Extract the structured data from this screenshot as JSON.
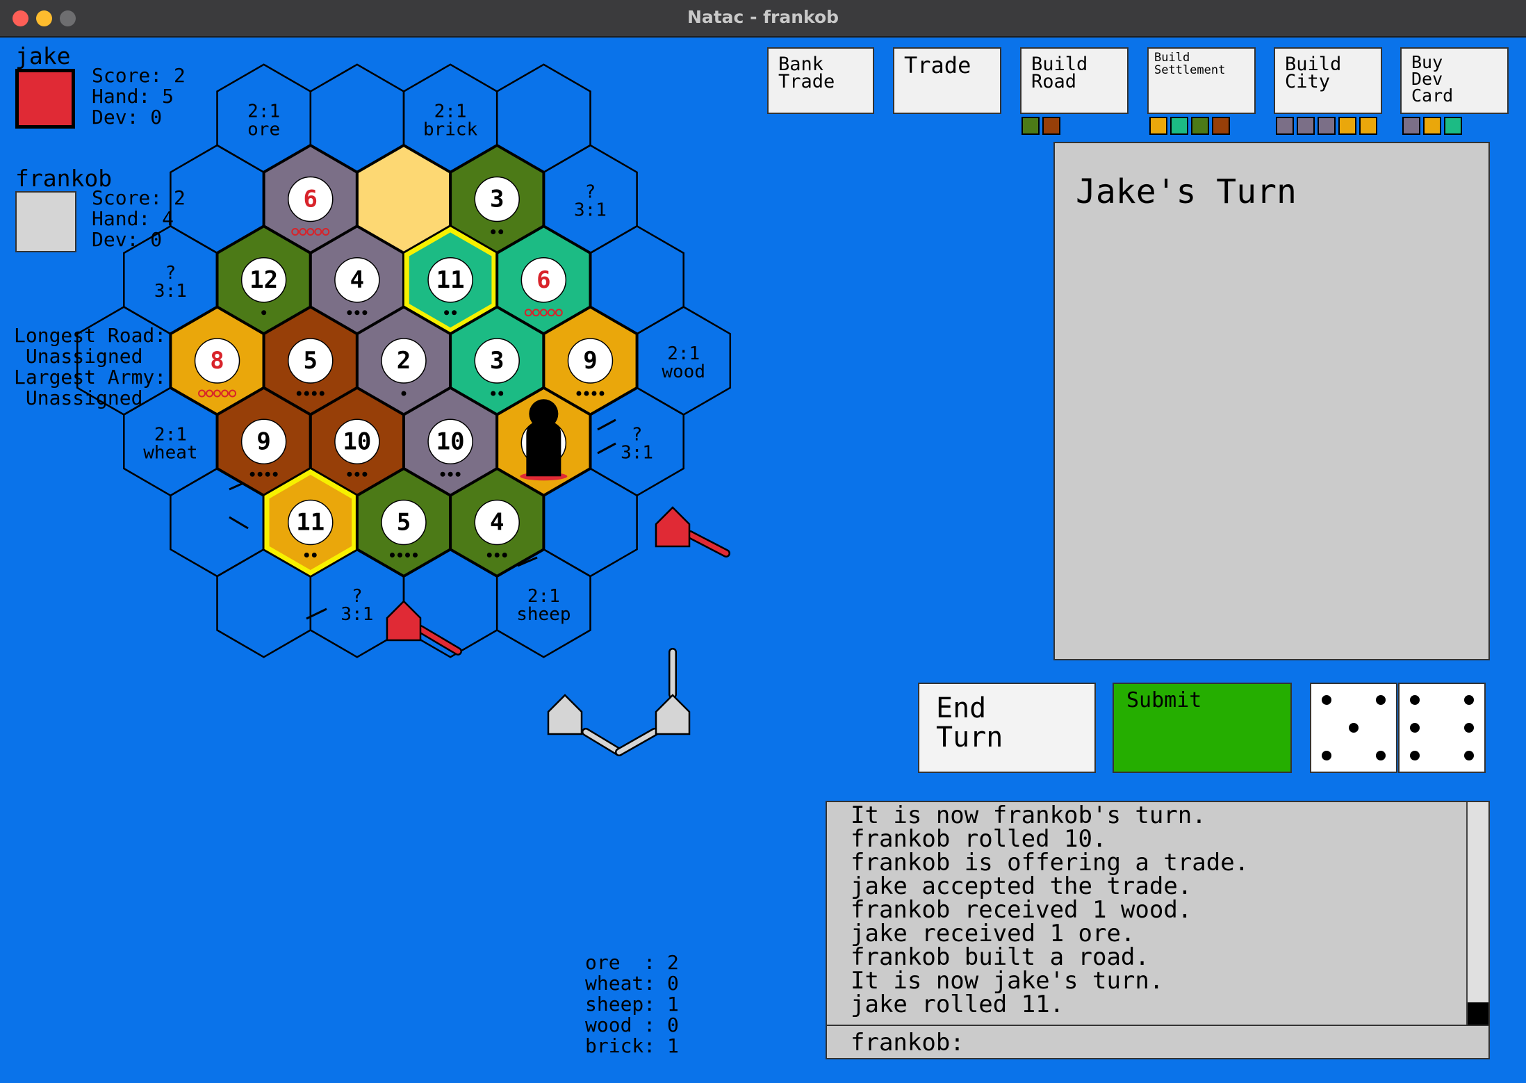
{
  "window": {
    "title": "Natac - frankob"
  },
  "colors": {
    "background": "#0a73ea",
    "ore": "#7b6f87",
    "wheat": "#eaa70b",
    "sheep": "#1cbb84",
    "wood": "#4c7a17",
    "brick": "#973f08",
    "desert": "#fdd873",
    "player_jake": "#e02a35",
    "player_frankob": "#d5d5d5",
    "highlight": "#f7f100",
    "submit": "#25ae00"
  },
  "players": [
    {
      "name": "jake",
      "score_label": "Score: 2",
      "hand_label": "Hand: 5",
      "dev_label": "Dev: 0",
      "color": "#e02a35"
    },
    {
      "name": "frankob",
      "score_label": "Score: 2",
      "hand_label": "Hand: 4",
      "dev_label": "Dev: 0",
      "color": "#d5d5d5"
    }
  ],
  "awards": {
    "longest_road": "Longest Road:",
    "longest_road_value": " Unassigned",
    "largest_army": "Largest Army:",
    "largest_army_value": " Unassigned"
  },
  "buttons": {
    "bank_trade": "Bank\nTrade",
    "trade": "Trade",
    "build_road": "Build\nRoad",
    "build_settlement": "Build\nSettlement",
    "build_city": "Build\nCity",
    "buy_dev_card": "Buy\nDev\nCard",
    "end_turn": "End\nTurn",
    "submit": "Submit"
  },
  "costs": {
    "build_road": [
      "wood",
      "brick"
    ],
    "build_settlement": [
      "wheat",
      "sheep",
      "wood",
      "brick"
    ],
    "build_city": [
      "ore",
      "ore",
      "ore",
      "wheat",
      "wheat"
    ],
    "buy_dev_card": [
      "ore",
      "wheat",
      "sheep"
    ]
  },
  "turn_panel": {
    "title": "Jake's Turn"
  },
  "dice": [
    5,
    6
  ],
  "board": {
    "tiles": [
      {
        "q": 0,
        "r": -2,
        "resource": "ore",
        "number": "6",
        "dots": 5,
        "hot": true
      },
      {
        "q": 1,
        "r": -2,
        "resource": "desert",
        "number": "",
        "dots": 0
      },
      {
        "q": 2,
        "r": -2,
        "resource": "wood",
        "number": "3",
        "dots": 2
      },
      {
        "q": -1,
        "r": -1,
        "resource": "wood",
        "number": "12",
        "dots": 1
      },
      {
        "q": 0,
        "r": -1,
        "resource": "ore",
        "number": "4",
        "dots": 3
      },
      {
        "q": 1,
        "r": -1,
        "resource": "sheep",
        "number": "11",
        "dots": 2,
        "highlight": true
      },
      {
        "q": 2,
        "r": -1,
        "resource": "sheep",
        "number": "6",
        "dots": 5,
        "hot": true
      },
      {
        "q": -2,
        "r": 0,
        "resource": "wheat",
        "number": "8",
        "dots": 5,
        "hot": true
      },
      {
        "q": -1,
        "r": 0,
        "resource": "brick",
        "number": "5",
        "dots": 4
      },
      {
        "q": 0,
        "r": 0,
        "resource": "ore",
        "number": "2",
        "dots": 1
      },
      {
        "q": 1,
        "r": 0,
        "resource": "sheep",
        "number": "3",
        "dots": 2
      },
      {
        "q": 2,
        "r": 0,
        "resource": "wheat",
        "number": "9",
        "dots": 4
      },
      {
        "q": -2,
        "r": 1,
        "resource": "brick",
        "number": "9",
        "dots": 4
      },
      {
        "q": -1,
        "r": 1,
        "resource": "brick",
        "number": "10",
        "dots": 3
      },
      {
        "q": 0,
        "r": 1,
        "resource": "ore",
        "number": "10",
        "dots": 3
      },
      {
        "q": 1,
        "r": 1,
        "resource": "wheat",
        "number": "",
        "dots": 0,
        "robber": true
      },
      {
        "q": -2,
        "r": 2,
        "resource": "wheat",
        "number": "11",
        "dots": 2,
        "highlight": true
      },
      {
        "q": -1,
        "r": 2,
        "resource": "wood",
        "number": "5",
        "dots": 4
      },
      {
        "q": 0,
        "r": 2,
        "resource": "wood",
        "number": "4",
        "dots": 3
      }
    ],
    "ports": [
      {
        "q": 0,
        "r": -3,
        "line1": "2:1",
        "line2": "ore"
      },
      {
        "q": 2,
        "r": -3,
        "line1": "2:1",
        "line2": "brick"
      },
      {
        "q": 3,
        "r": -2,
        "line1": "?",
        "line2": "3:1"
      },
      {
        "q": -2,
        "r": -1,
        "line1": "?",
        "line2": "3:1"
      },
      {
        "q": 3,
        "r": 0,
        "line1": "2:1",
        "line2": "wood"
      },
      {
        "q": -3,
        "r": 1,
        "line1": "2:1",
        "line2": "wheat"
      },
      {
        "q": 2,
        "r": 1,
        "line1": "?",
        "line2": "3:1"
      },
      {
        "q": -2,
        "r": 3,
        "line1": "?",
        "line2": "3:1"
      },
      {
        "q": 0,
        "r": 3,
        "line1": "2:1",
        "line2": "sheep"
      }
    ]
  },
  "log": {
    "lines": [
      "It is now frankob's turn.",
      "frankob rolled 10.",
      "frankob is offering a trade.",
      "jake accepted the trade.",
      "frankob received 1 wood.",
      "jake received 1 ore.",
      "frankob built a road.",
      "It is now jake's turn.",
      "jake rolled 11."
    ],
    "chat_label": "frankob:"
  },
  "resources": {
    "lines": [
      "ore  : 2",
      "wheat: 0",
      "sheep: 1",
      "wood : 0",
      "brick: 1"
    ]
  }
}
